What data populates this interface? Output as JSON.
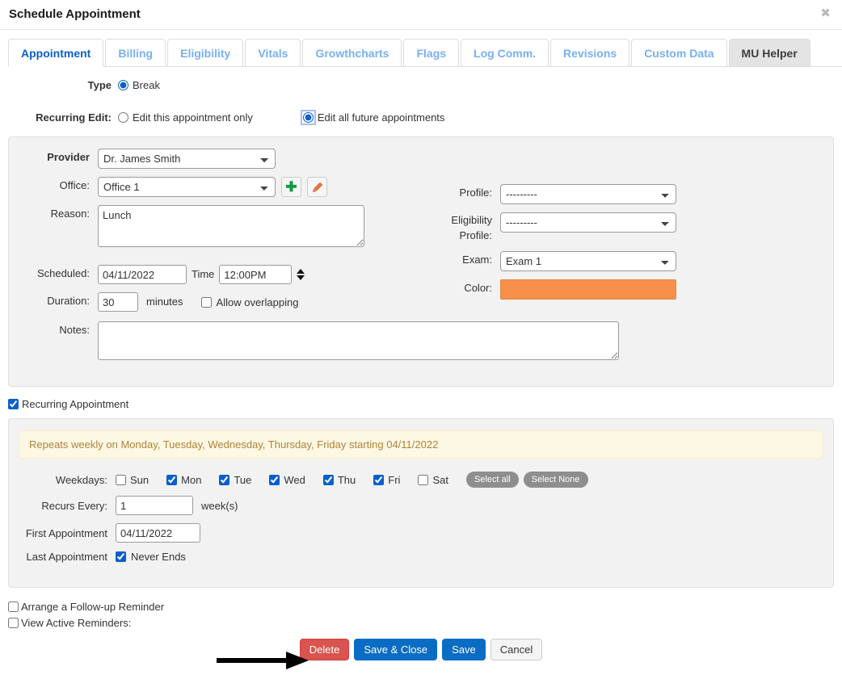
{
  "modal": {
    "title": "Schedule Appointment",
    "close_icon": "close-icon",
    "close_glyph": "✖"
  },
  "tabs": [
    {
      "label": "Appointment",
      "state": "active"
    },
    {
      "label": "Billing",
      "state": "normal"
    },
    {
      "label": "Eligibility",
      "state": "normal"
    },
    {
      "label": "Vitals",
      "state": "normal"
    },
    {
      "label": "Growthcharts",
      "state": "normal"
    },
    {
      "label": "Flags",
      "state": "normal"
    },
    {
      "label": "Log Comm.",
      "state": "normal"
    },
    {
      "label": "Revisions",
      "state": "normal"
    },
    {
      "label": "Custom Data",
      "state": "normal"
    },
    {
      "label": "MU Helper",
      "state": "hovered"
    }
  ],
  "type_row": {
    "label": "Type",
    "option_label": "Break",
    "checked": true
  },
  "recurring_edit": {
    "label": "Recurring Edit:",
    "option_this": "Edit this appointment only",
    "option_future": "Edit all future appointments",
    "selected": "future"
  },
  "form": {
    "provider": {
      "label": "Provider",
      "value": "Dr. James Smith"
    },
    "office": {
      "label": "Office:",
      "value": "Office 1",
      "add_icon": "plus-icon",
      "edit_icon": "pencil-icon",
      "add_glyph": "✚"
    },
    "reason": {
      "label": "Reason:",
      "value": "Lunch"
    },
    "scheduled": {
      "label": "Scheduled:",
      "value": "04/11/2022"
    },
    "time": {
      "label": "Time",
      "value": "12:00PM",
      "spinner_icon": "spinner-updown-icon"
    },
    "duration": {
      "label": "Duration:",
      "value": "30",
      "unit": "minutes"
    },
    "allow_overlapping": {
      "label": "Allow overlapping",
      "checked": false
    },
    "notes": {
      "label": "Notes:",
      "value": ""
    },
    "profile": {
      "label": "Profile:",
      "value": "---------"
    },
    "eligibility_profile": {
      "label_line1": "Eligibility",
      "label_line2": "Profile:",
      "value": "---------"
    },
    "exam": {
      "label": "Exam:",
      "value": "Exam 1"
    },
    "color": {
      "label": "Color:",
      "value": "#f7904a"
    }
  },
  "recurring": {
    "checkbox_label": "Recurring Appointment",
    "checked": true,
    "summary": "Repeats weekly on Monday, Tuesday, Wednesday, Thursday, Friday starting 04/11/2022",
    "weekdays_label": "Weekdays:",
    "weekdays": [
      {
        "label": "Sun",
        "checked": false
      },
      {
        "label": "Mon",
        "checked": true
      },
      {
        "label": "Tue",
        "checked": true
      },
      {
        "label": "Wed",
        "checked": true
      },
      {
        "label": "Thu",
        "checked": true
      },
      {
        "label": "Fri",
        "checked": true
      },
      {
        "label": "Sat",
        "checked": false
      }
    ],
    "select_all": "Select all",
    "select_none": "Select None",
    "recurs_every": {
      "label": "Recurs Every:",
      "value": "1",
      "unit": "week(s)"
    },
    "first_appointment": {
      "label": "First Appointment",
      "value": "04/11/2022"
    },
    "last_appointment": {
      "label": "Last Appointment",
      "never_ends_label": "Never Ends",
      "never_ends_checked": true
    }
  },
  "bottom": {
    "arrange_followup": {
      "label": "Arrange a Follow-up Reminder",
      "checked": false
    },
    "view_active_reminders": {
      "label": "View Active Reminders:",
      "checked": false
    }
  },
  "buttons": {
    "delete": "Delete",
    "save_close": "Save & Close",
    "save": "Save",
    "cancel": "Cancel"
  },
  "annotation": {
    "arrow_icon": "arrow-right-annotation",
    "points_to": "Delete"
  },
  "colors": {
    "accent_blue": "#0a6cc4",
    "danger_red": "#d9534f",
    "appointment_orange": "#f7904a",
    "alert_bg": "#fcf8e3",
    "alert_text": "#b08338"
  }
}
